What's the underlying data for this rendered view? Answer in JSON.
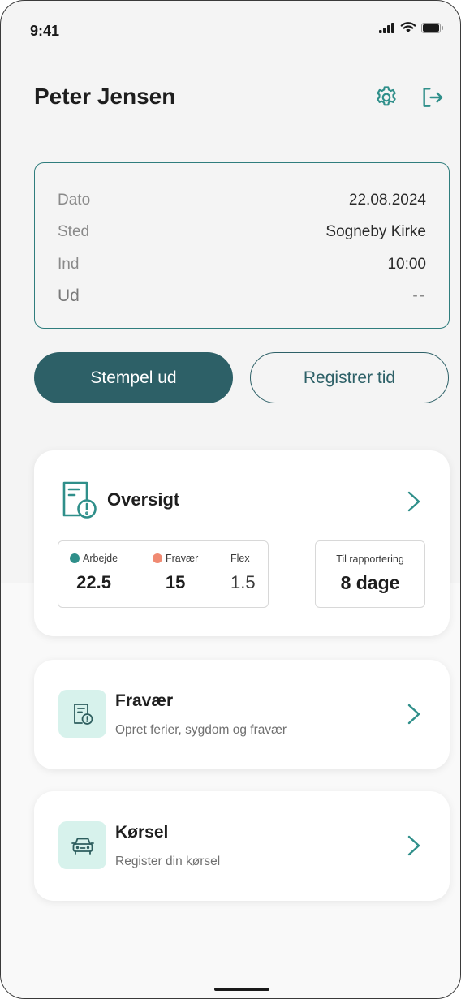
{
  "status": {
    "time": "9:41"
  },
  "header": {
    "title": "Peter Jensen"
  },
  "info": {
    "rows": [
      {
        "label": "Dato",
        "value": "22.08.2024"
      },
      {
        "label": "Sted",
        "value": "Sogneby Kirke"
      },
      {
        "label": "Ind",
        "value": "10:00"
      },
      {
        "label": "Ud",
        "value": "--"
      }
    ]
  },
  "actions": {
    "primary_label": "Stempel ud",
    "secondary_label": "Registrer tid"
  },
  "overview": {
    "title": "Oversigt",
    "stats": [
      {
        "label": "Arbejde",
        "value": "22.5",
        "dot_color": "#2f8f8a"
      },
      {
        "label": "Fravær",
        "value": "15",
        "dot_color": "#f08a72"
      },
      {
        "label": "Flex",
        "value": "1.5"
      }
    ],
    "report": {
      "label": "Til rapportering",
      "value": "8 dage"
    }
  },
  "features": [
    {
      "title": "Fravær",
      "subtitle": "Opret ferier, sygdom og fravær",
      "icon": "document-clock-icon"
    },
    {
      "title": "Kørsel",
      "subtitle": "Register din kørsel",
      "icon": "car-icon"
    }
  ],
  "colors": {
    "accent": "#2d6067",
    "teal": "#2f8f8a",
    "icon_bg": "#d7f2ec"
  }
}
